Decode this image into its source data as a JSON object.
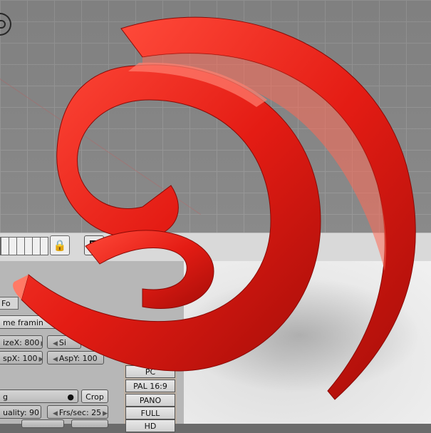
{
  "header": {
    "lock_icon": "lock-icon",
    "render_icon": "image-icon"
  },
  "panel": {
    "tab_format": "Fo",
    "framing": "me framin",
    "size_x": "izeX: 800",
    "size_y": "Si",
    "asp_x": "spX: 100",
    "asp_y": "AspY: 100",
    "format_value": "g",
    "crop": "Crop",
    "quality": "uality: 90",
    "fps": "Frs/sec: 25",
    "presets": [
      "PC",
      "PAL 16:9",
      "PANO",
      "FULL",
      "HD"
    ]
  },
  "colors": {
    "logo_red": "#e41c14",
    "viewport_gray": "#8a8a8a",
    "panel_gray": "#b7b7b7"
  }
}
